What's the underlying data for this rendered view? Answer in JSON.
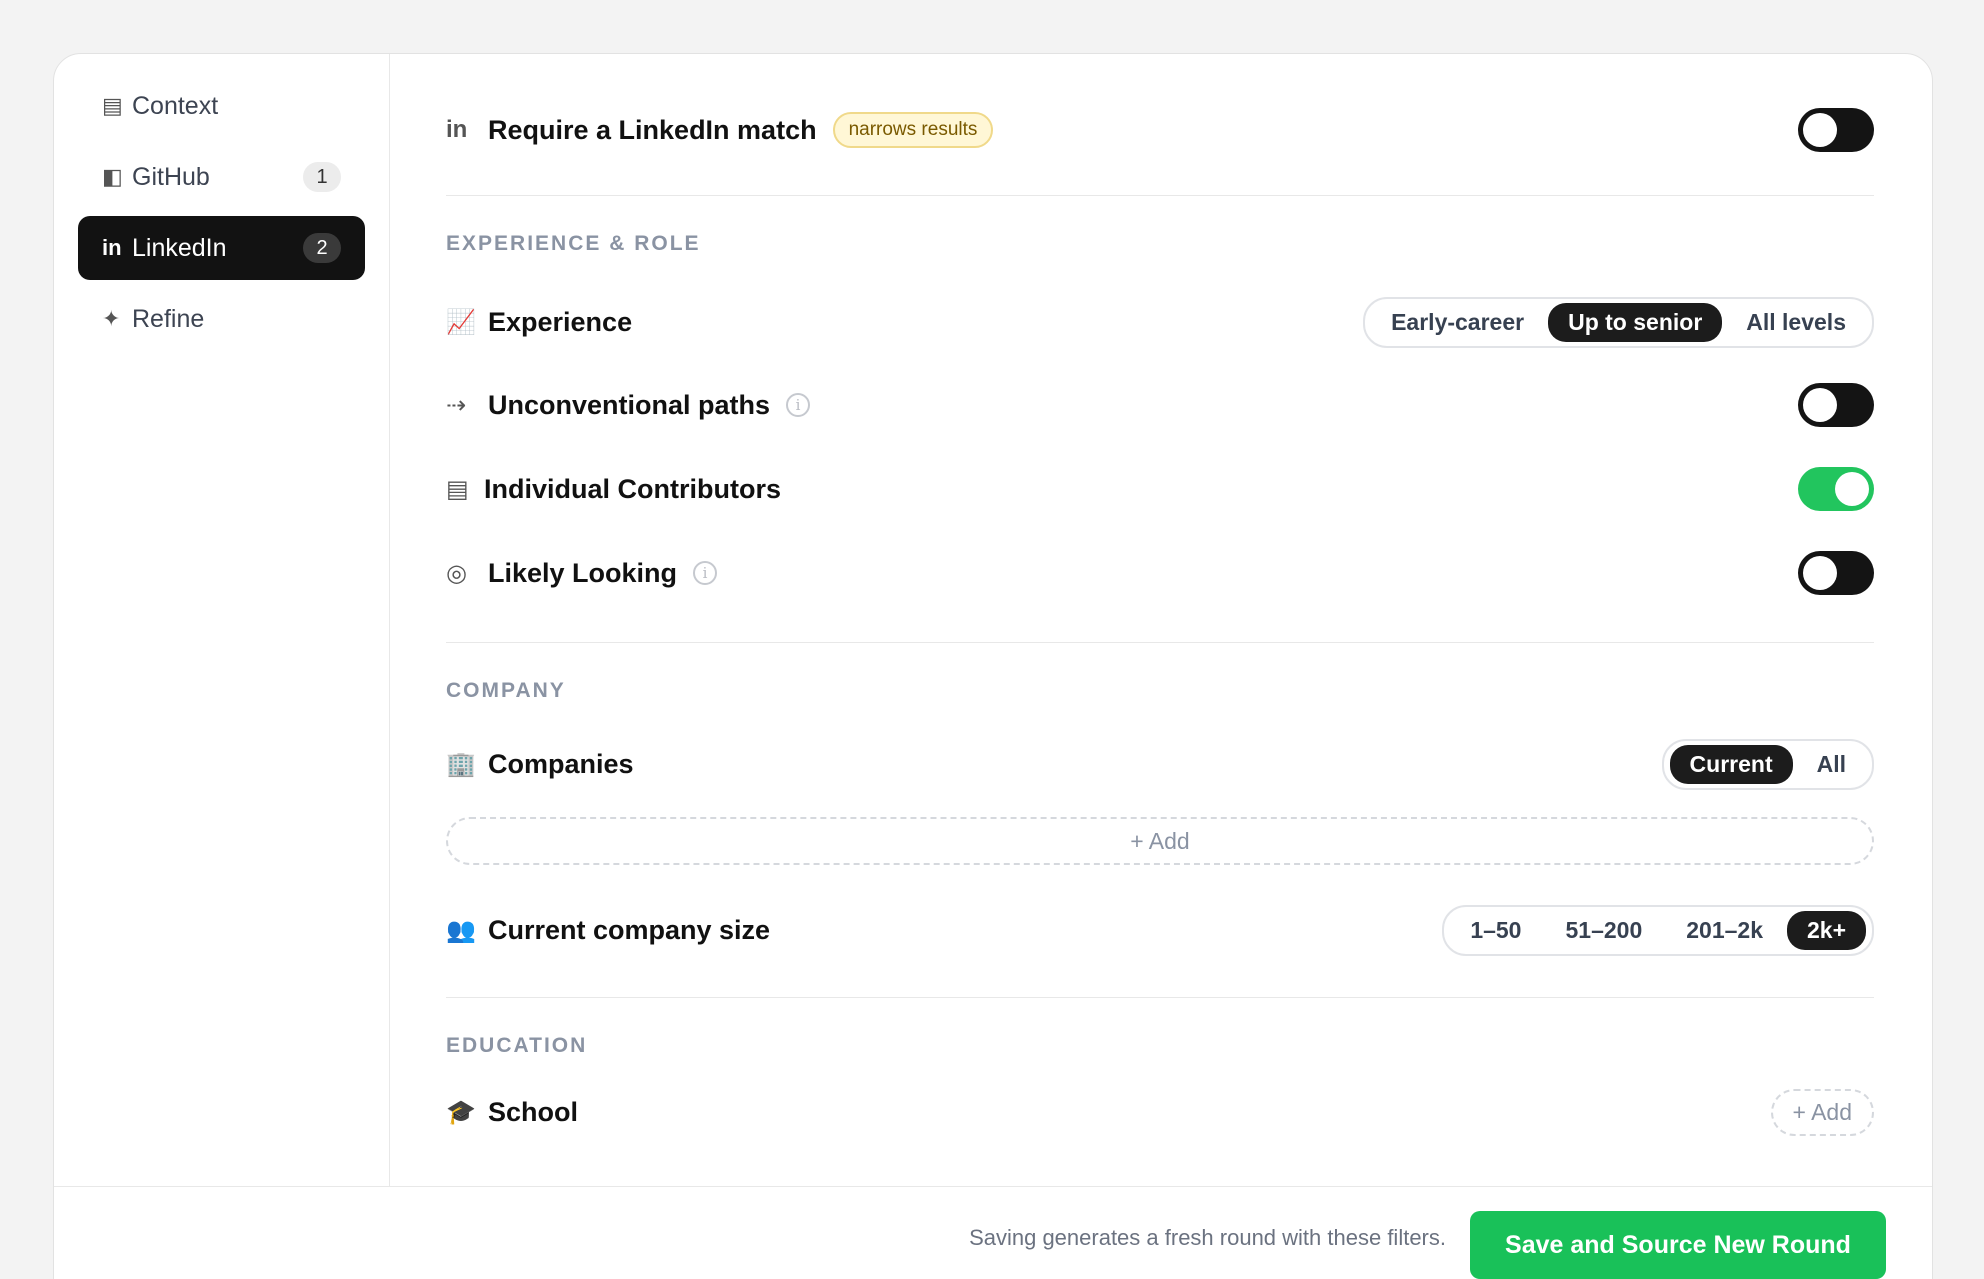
{
  "sidebar": {
    "items": [
      {
        "icon": "▤",
        "label": "Context",
        "badge": ""
      },
      {
        "icon": "◧",
        "label": "GitHub",
        "badge": "1"
      },
      {
        "icon": "in",
        "label": "LinkedIn",
        "badge": "2"
      },
      {
        "icon": "✦",
        "label": "Refine",
        "badge": ""
      }
    ]
  },
  "linkedin_match": {
    "icon": "in",
    "title": "Require a LinkedIn match",
    "note": "narrows results",
    "toggle_on": false
  },
  "experience_section": {
    "label": "EXPERIENCE & ROLE",
    "experience": {
      "icon": "📈",
      "title": "Experience",
      "options": [
        "Early-career",
        "Up to senior",
        "All levels"
      ],
      "selected": "Up to senior"
    },
    "unconventional": {
      "icon": "⇢",
      "title": "Unconventional paths",
      "info": "i",
      "toggle_on": false
    },
    "individual": {
      "icon": "▤",
      "title": "Individual Contributors",
      "toggle_on": true
    },
    "likely_looking": {
      "icon": "◎",
      "title": "Likely Looking",
      "info": "i",
      "toggle_on": false
    }
  },
  "company_section": {
    "label": "COMPANY",
    "companies": {
      "icon": "🏢",
      "title": "Companies",
      "options": [
        "Current",
        "All"
      ],
      "selected": "Current",
      "add_label": "+ Add"
    },
    "size": {
      "icon": "👥",
      "title": "Current company size",
      "options": [
        "1–50",
        "51–200",
        "201–2k",
        "2k+"
      ],
      "selected": "2k+"
    }
  },
  "education_section": {
    "label": "EDUCATION",
    "school": {
      "icon": "🎓",
      "title": "School",
      "add_label": "+ Add"
    }
  },
  "footer": {
    "note": "Saving generates a fresh round with these filters.",
    "button_label": "Save and Source New Round"
  },
  "colors": {
    "accent_green": "#19c159",
    "toggle_on": "#22c55e",
    "dark": "#121212"
  }
}
